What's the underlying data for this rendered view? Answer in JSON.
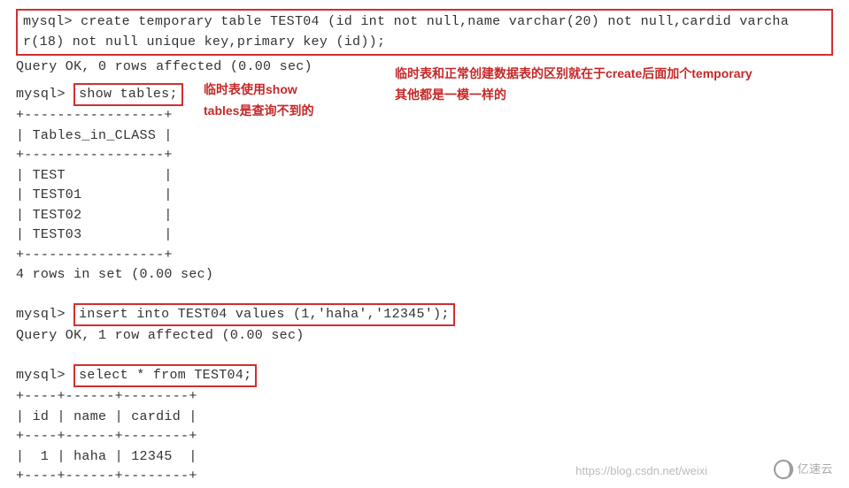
{
  "terminal": {
    "prompt": "mysql>",
    "create_stmt_line1": "mysql> create temporary table TEST04 (id int not null,name varchar(20) not null,cardid varcha",
    "create_stmt_line2": "r(18) not null unique key,primary key (id));",
    "create_result": "Query OK, 0 rows affected (0.00 sec)",
    "show_tables_cmd": "show tables;",
    "table_border": "+-----------------+",
    "table_header": "| Tables_in_CLASS |",
    "table_rows": [
      "| TEST            |",
      "| TEST01          |",
      "| TEST02          |",
      "| TEST03          |"
    ],
    "show_tables_result": "4 rows in set (0.00 sec)",
    "insert_cmd": "insert into TEST04 values (1,'haha','12345');",
    "insert_result": "Query OK, 1 row affected (0.00 sec)",
    "select_cmd": "select * from TEST04;",
    "result_border": "+----+------+--------+",
    "result_header": "| id | name | cardid |",
    "result_row": "|  1 | haha | 12345  |"
  },
  "annotations": {
    "left_note": "临时表使用show\ntables是查询不到的",
    "right_note": "临时表和正常创建数据表的区别就在于create后面加个temporary\n其他都是一模一样的"
  },
  "watermarks": {
    "csdn": "https://blog.csdn.net/weixi",
    "brand": "亿速云"
  }
}
